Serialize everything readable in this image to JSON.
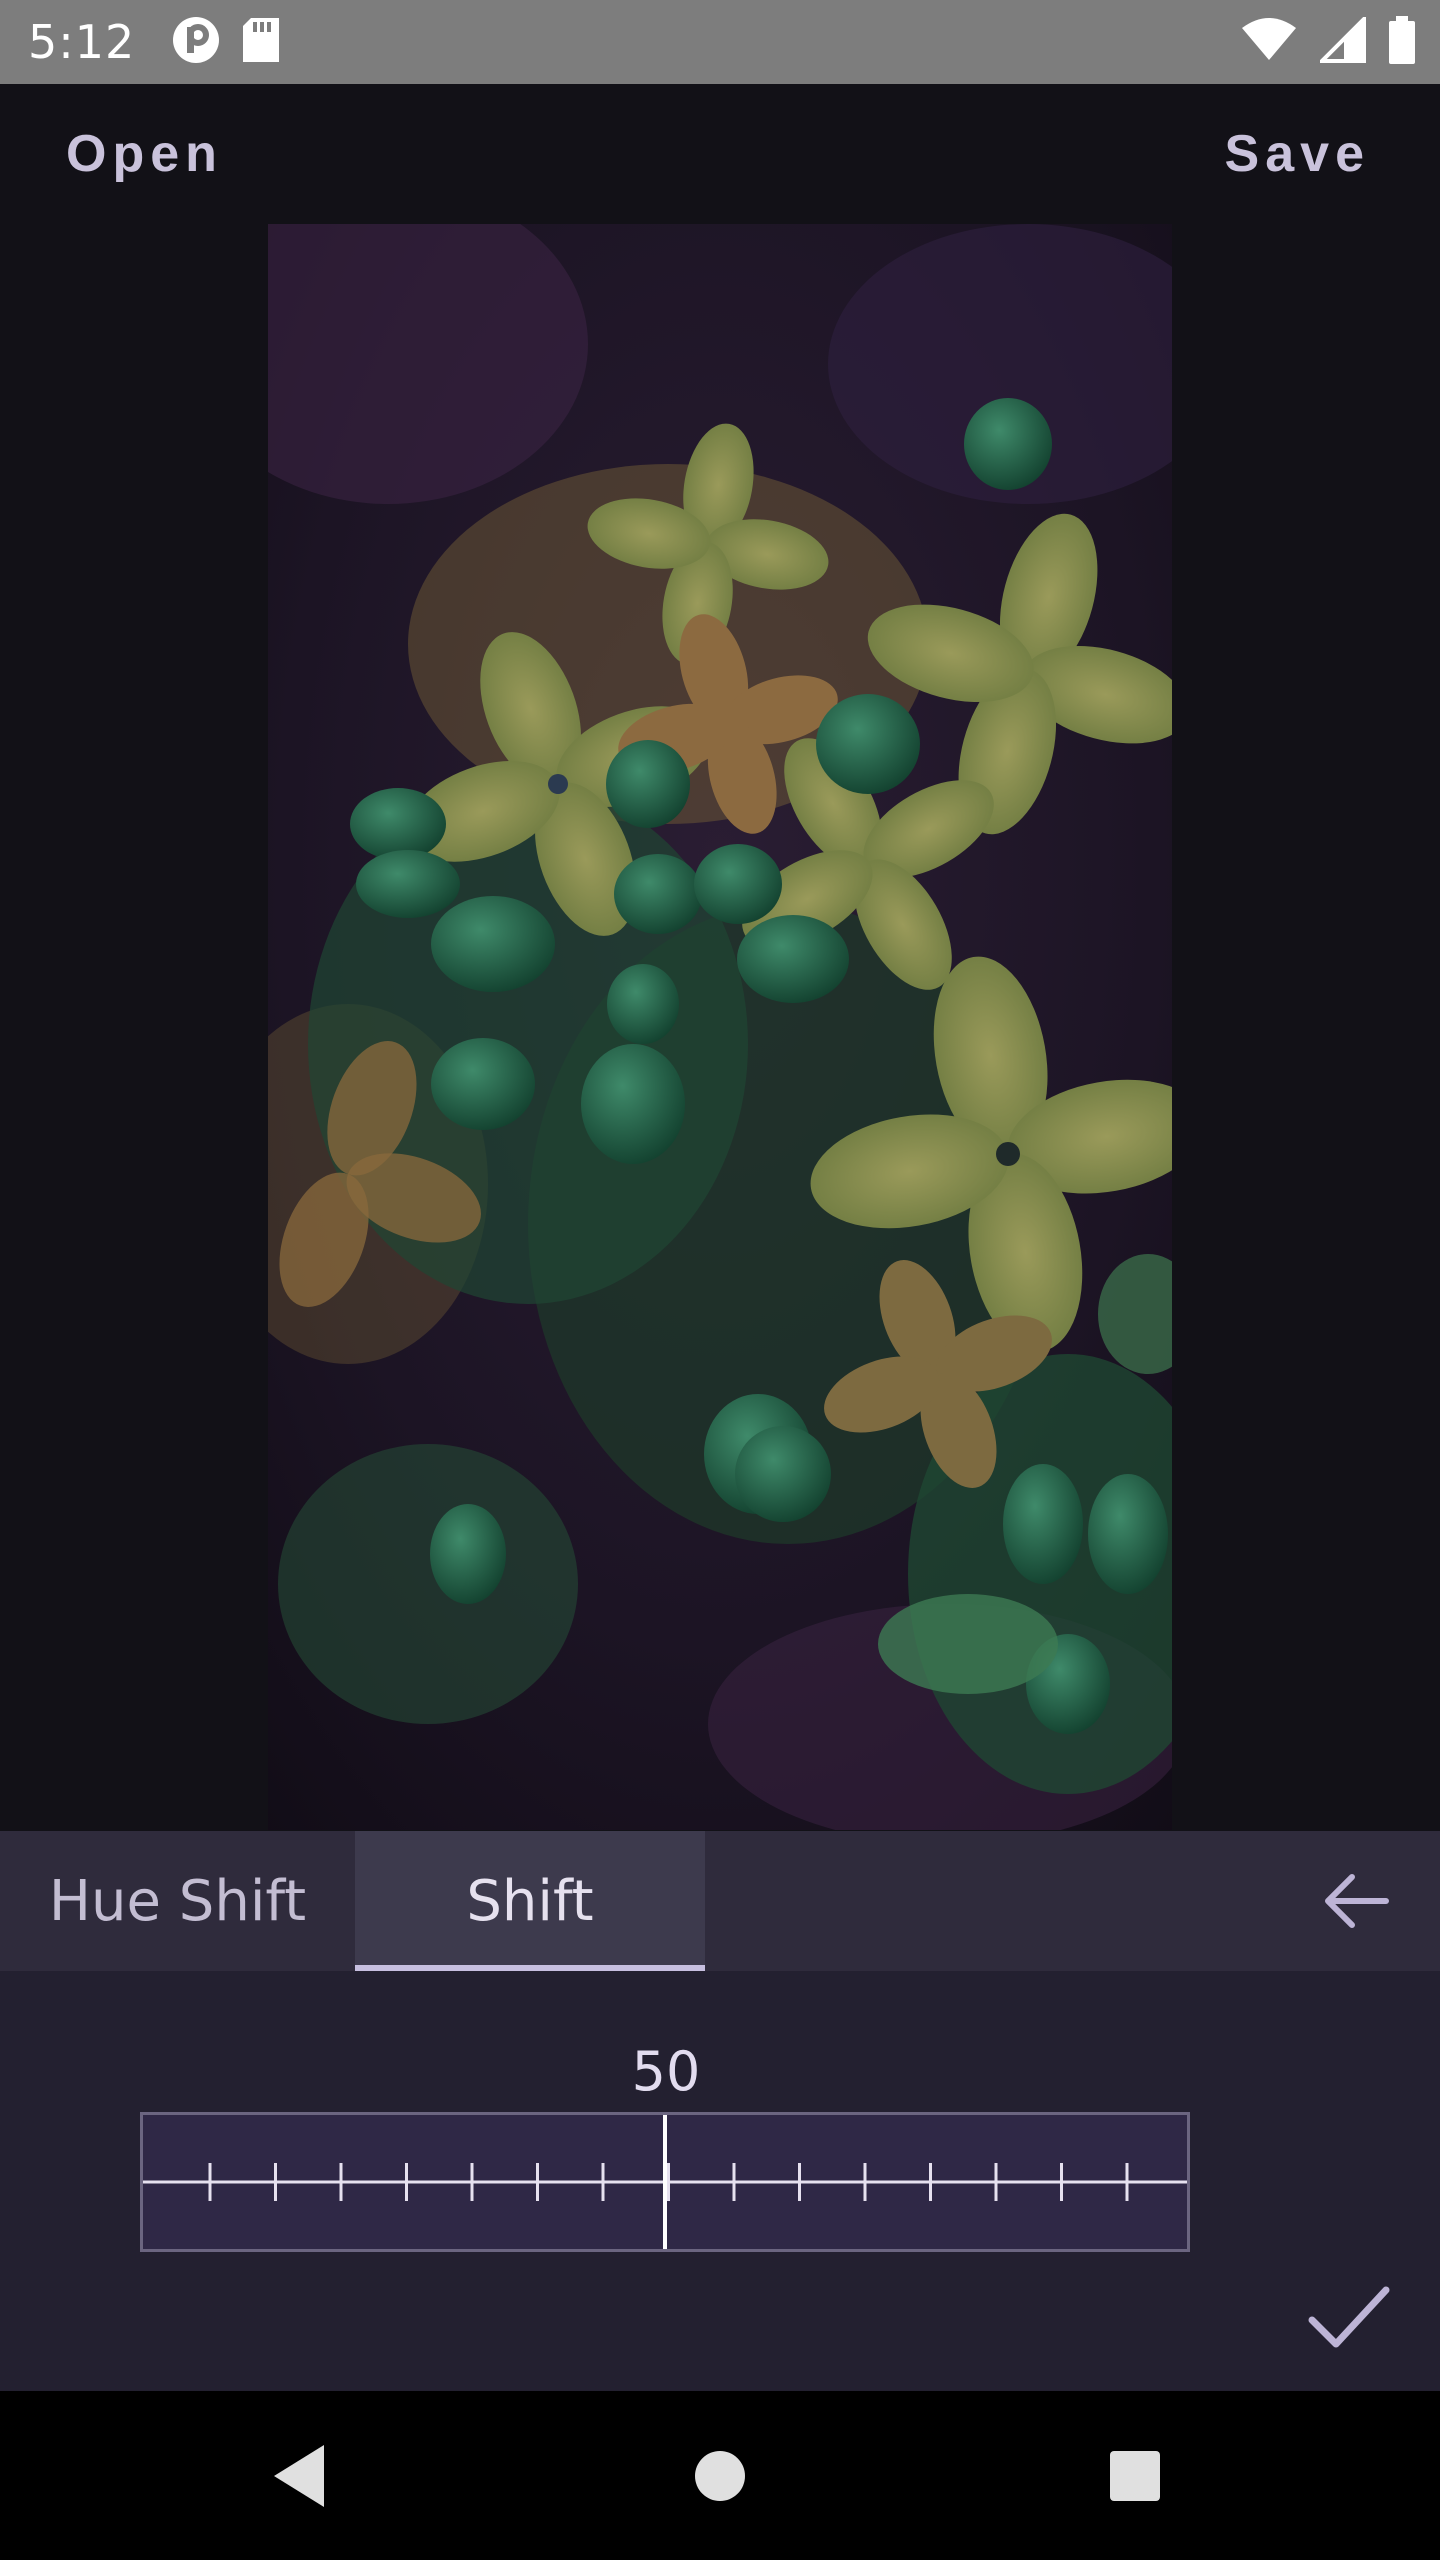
{
  "status_bar": {
    "time": "5:12",
    "left_icons": [
      "p-icon",
      "sd-card-icon"
    ],
    "right_icons": [
      "wifi-icon",
      "cell-signal-icon",
      "battery-icon"
    ]
  },
  "toolbar": {
    "open_label": "Open",
    "save_label": "Save"
  },
  "image": {
    "description_icon": "flower-photo"
  },
  "tabs": [
    {
      "label": "Hue Shift",
      "selected": false
    },
    {
      "label": "Shift",
      "selected": true
    }
  ],
  "slider": {
    "value": "50",
    "level": 0.5
  },
  "actions": {
    "back_icon": "arrow-left-icon",
    "confirm_icon": "check-icon"
  },
  "nav": [
    "back-triangle-icon",
    "home-circle-icon",
    "recents-square-icon"
  ],
  "colors": {
    "background": "#121117",
    "tabbar": "#2f2b3c",
    "accent": "#c7bfe0",
    "panel": "#232030"
  }
}
